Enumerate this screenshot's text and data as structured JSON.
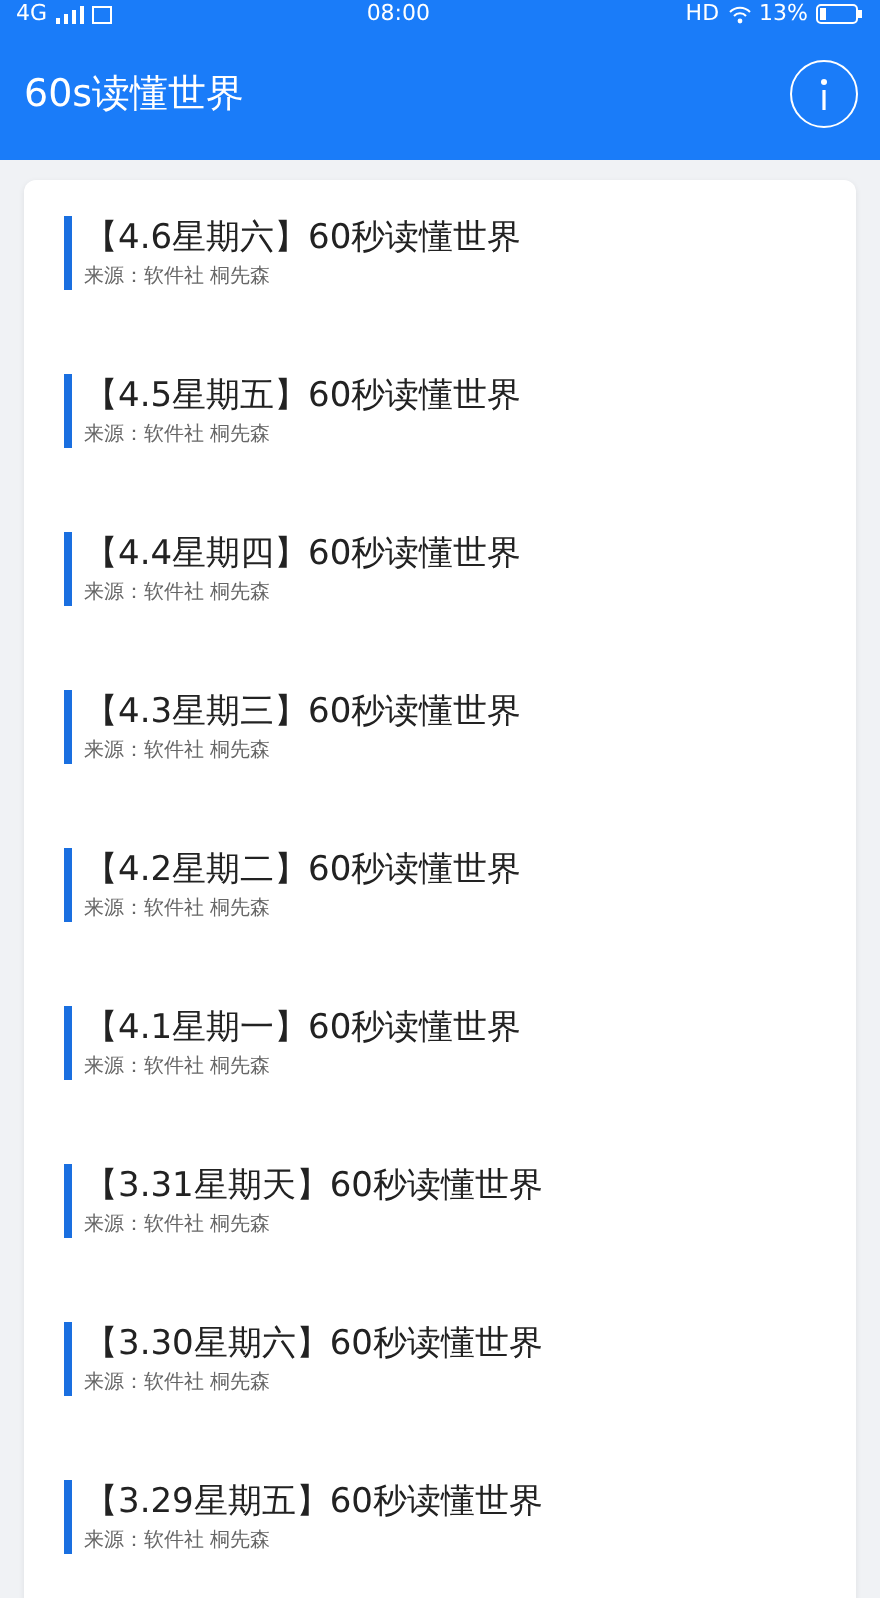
{
  "status_bar": {
    "network": "4G",
    "time": "08:00",
    "hd": "HD",
    "battery": "13%"
  },
  "header": {
    "title": "60s读懂世界"
  },
  "articles": [
    {
      "title": "【4.6星期六】60秒读懂世界",
      "source": "来源：软件社 桐先森"
    },
    {
      "title": "【4.5星期五】60秒读懂世界",
      "source": "来源：软件社 桐先森"
    },
    {
      "title": "【4.4星期四】60秒读懂世界",
      "source": "来源：软件社 桐先森"
    },
    {
      "title": "【4.3星期三】60秒读懂世界",
      "source": "来源：软件社 桐先森"
    },
    {
      "title": "【4.2星期二】60秒读懂世界",
      "source": "来源：软件社 桐先森"
    },
    {
      "title": "【4.1星期一】60秒读懂世界",
      "source": "来源：软件社 桐先森"
    },
    {
      "title": "【3.31星期天】60秒读懂世界",
      "source": "来源：软件社 桐先森"
    },
    {
      "title": "【3.30星期六】60秒读懂世界",
      "source": "来源：软件社 桐先森"
    },
    {
      "title": "【3.29星期五】60秒读懂世界",
      "source": "来源：软件社 桐先森"
    }
  ]
}
